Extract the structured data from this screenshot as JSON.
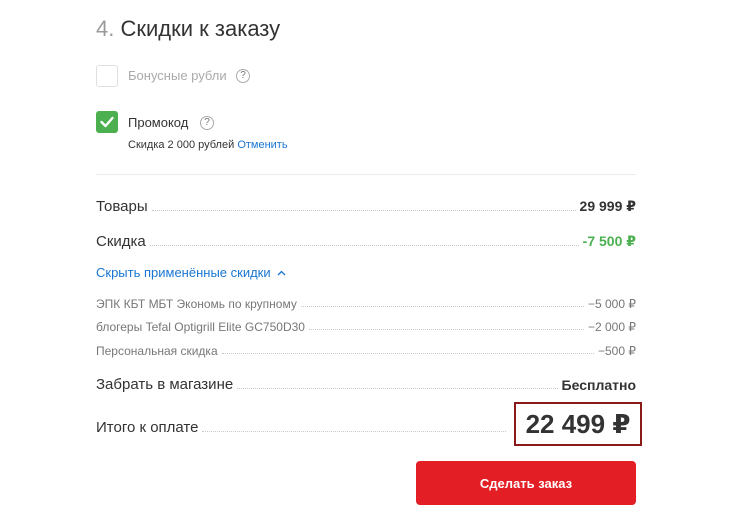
{
  "section": {
    "number": "4.",
    "title": "Скидки к заказу"
  },
  "bonus": {
    "label": "Бонусные рубли",
    "help": "?",
    "checked": false
  },
  "promocode": {
    "label": "Промокод",
    "help": "?",
    "checked": true,
    "note": "Скидка 2 000 рублей",
    "cancel_link": "Отменить"
  },
  "summary": {
    "goods": {
      "label": "Товары",
      "value": "29 999 ₽"
    },
    "discount": {
      "label": "Скидка",
      "value": "-7 500 ₽"
    },
    "toggle_discounts": "Скрыть применённые скидки",
    "discounts": [
      {
        "label": "ЭПК КБТ МБТ Экономь по крупному",
        "value": "−5 000 ₽"
      },
      {
        "label": "блогеры Tefal Optigrill Elite GC750D30",
        "value": "−2 000 ₽"
      },
      {
        "label": "Персональная скидка",
        "value": "−500 ₽"
      }
    ],
    "pickup": {
      "label": "Забрать в магазине",
      "value": "Бесплатно"
    },
    "total": {
      "label": "Итого к оплате",
      "value": "22 499 ₽"
    }
  },
  "order_button": "Сделать заказ",
  "colors": {
    "accent_red": "#e31e24",
    "discount_green": "#4caf50",
    "link_blue": "#1976d2",
    "total_box_border": "#8b1a1a"
  }
}
